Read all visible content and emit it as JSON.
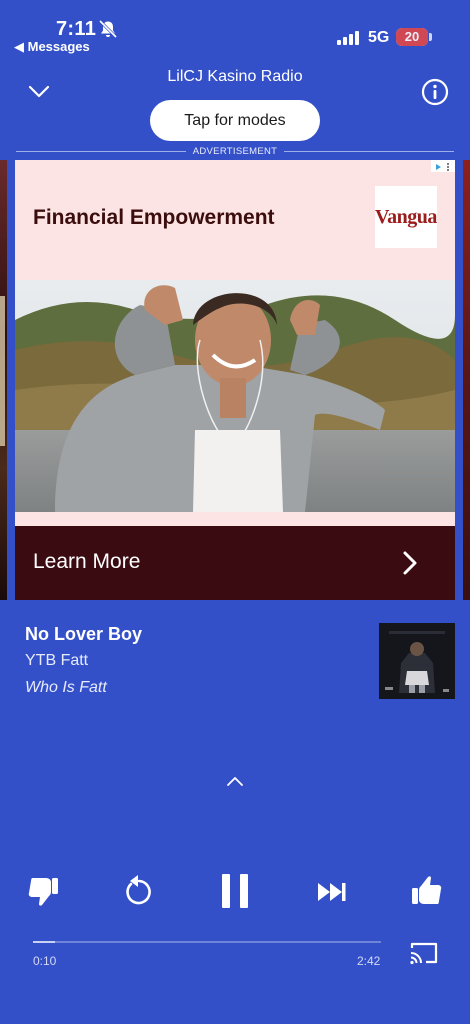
{
  "status_bar": {
    "time": "7:11",
    "back_app": "◀ Messages",
    "network": "5G",
    "battery": "20"
  },
  "header": {
    "station_name": "LilCJ Kasino Radio",
    "modes_button": "Tap for modes",
    "ad_label": "ADVERTISEMENT"
  },
  "ad": {
    "headline": "Financial Empowerment",
    "logo_text": "Vangua",
    "cta": "Learn More"
  },
  "track": {
    "title": "No Lover Boy",
    "artist": "YTB Fatt",
    "album": "Who Is Fatt"
  },
  "player": {
    "elapsed": "0:10",
    "duration": "2:42",
    "progress_fraction": 0.062
  },
  "icons": {
    "collapse": "chevron-down-icon",
    "info": "info-icon",
    "expand": "chevron-up-icon",
    "thumb_down": "thumb-down-icon",
    "replay": "replay-icon",
    "pause": "pause-icon",
    "skip": "skip-next-icon",
    "thumb_up": "thumb-up-icon",
    "cast": "cast-icon",
    "silent": "bell-off-icon",
    "signal": "signal-icon"
  },
  "colors": {
    "background": "#3450c9",
    "ad_background": "#fbe4e3",
    "ad_cta": "#3a0b10",
    "battery_low": "#e04848"
  }
}
